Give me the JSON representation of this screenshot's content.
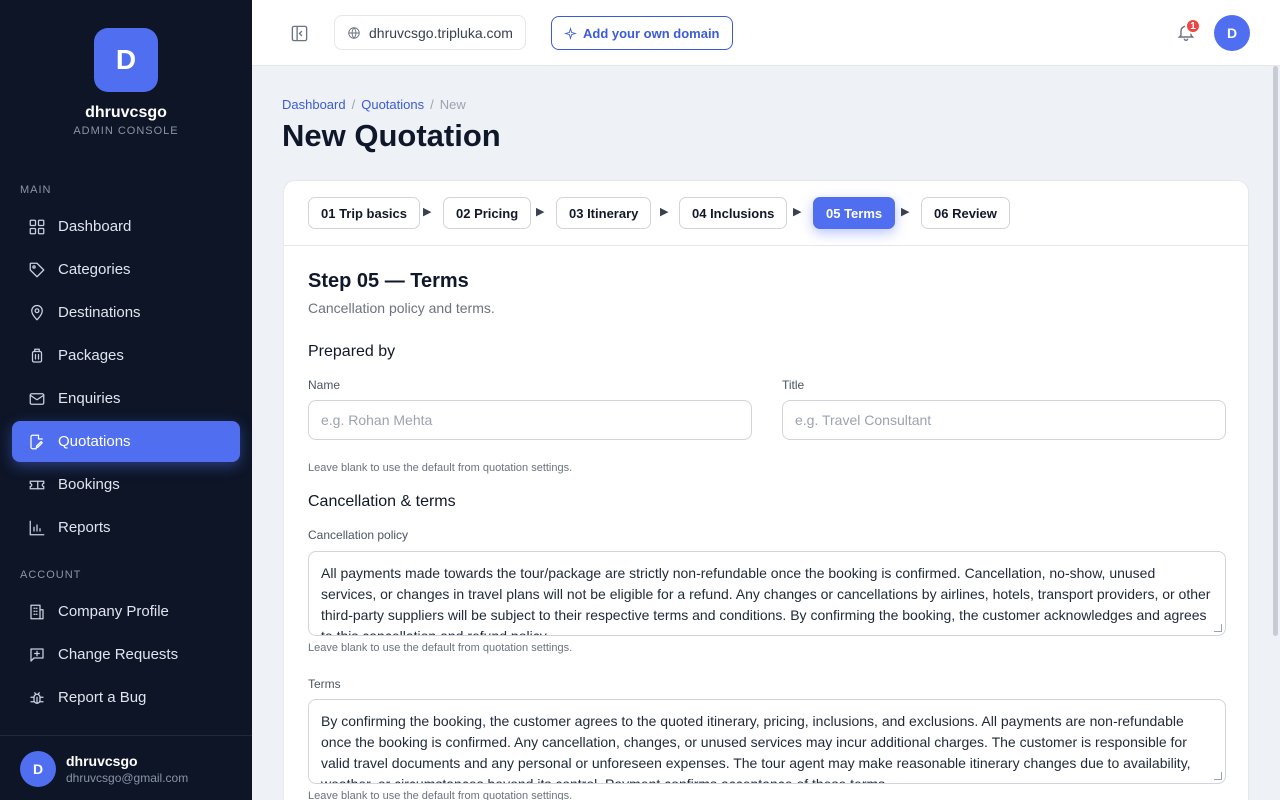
{
  "sidebar": {
    "brand_initial": "D",
    "brand_name": "dhruvcsgo",
    "brand_sub": "ADMIN CONSOLE",
    "main_label": "MAIN",
    "account_label": "ACCOUNT",
    "main_items": [
      {
        "label": "Dashboard",
        "icon": "grid-icon"
      },
      {
        "label": "Categories",
        "icon": "tag-icon"
      },
      {
        "label": "Destinations",
        "icon": "map-pin-icon"
      },
      {
        "label": "Packages",
        "icon": "luggage-icon"
      },
      {
        "label": "Enquiries",
        "icon": "mail-icon"
      },
      {
        "label": "Quotations",
        "icon": "file-edit-icon",
        "active": true
      },
      {
        "label": "Bookings",
        "icon": "ticket-icon"
      },
      {
        "label": "Reports",
        "icon": "bar-chart-icon"
      }
    ],
    "account_items": [
      {
        "label": "Company Profile",
        "icon": "building-icon"
      },
      {
        "label": "Change Requests",
        "icon": "message-plus-icon"
      },
      {
        "label": "Report a Bug",
        "icon": "bug-icon"
      }
    ],
    "user": {
      "initial": "D",
      "name": "dhruvcsgo",
      "email": "dhruvcsgo@gmail.com"
    }
  },
  "topbar": {
    "domain": "dhruvcsgo.tripluka.com",
    "add_domain": "Add your own domain",
    "notifications_count": "1",
    "avatar_initial": "D"
  },
  "breadcrumb": {
    "home": "Dashboard",
    "parent": "Quotations",
    "current": "New",
    "sep": "/"
  },
  "page_title": "New Quotation",
  "steps": [
    {
      "label": "01 Trip basics"
    },
    {
      "label": "02 Pricing"
    },
    {
      "label": "03 Itinerary"
    },
    {
      "label": "04 Inclusions"
    },
    {
      "label": "05 Terms",
      "active": true
    },
    {
      "label": "06 Review"
    }
  ],
  "form": {
    "heading": "Step 05 — Terms",
    "subheading": "Cancellation policy and terms.",
    "prepared_by_title": "Prepared by",
    "name_label": "Name",
    "name_placeholder": "e.g. Rohan Mehta",
    "title_label": "Title",
    "title_placeholder": "e.g. Travel Consultant",
    "prepared_hint": "Leave blank to use the default from quotation settings.",
    "cancellation_section_title": "Cancellation & terms",
    "cancellation_label": "Cancellation policy",
    "cancellation_value": "All payments made towards the tour/package are strictly non-refundable once the booking is confirmed. Cancellation, no-show, unused services, or changes in travel plans will not be eligible for a refund. Any changes or cancellations by airlines, hotels, transport providers, or other third-party suppliers will be subject to their respective terms and conditions. By confirming the booking, the customer acknowledges and agrees to this cancellation and refund policy.",
    "cancellation_hint": "Leave blank to use the default from quotation settings.",
    "terms_label": "Terms",
    "terms_value": "By confirming the booking, the customer agrees to the quoted itinerary, pricing, inclusions, and exclusions. All payments are non-refundable once the booking is confirmed. Any cancellation, changes, or unused services may incur additional charges. The customer is responsible for valid travel documents and any personal or unforeseen expenses. The tour agent may make reasonable itinerary changes due to availability, weather, or circumstances beyond its control. Payment confirms acceptance of these terms.",
    "terms_hint": "Leave blank to use the default from quotation settings."
  }
}
